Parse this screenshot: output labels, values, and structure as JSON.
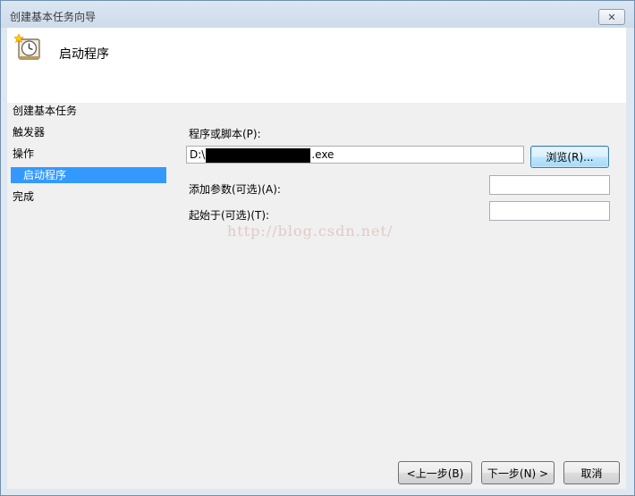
{
  "window": {
    "title": "创建基本任务向导",
    "close_glyph": "✕"
  },
  "header": {
    "title": "启动程序",
    "icon": "task-scheduler-clock-icon"
  },
  "nav": {
    "items": [
      {
        "label": "创建基本任务"
      },
      {
        "label": "触发器"
      },
      {
        "label": "操作"
      },
      {
        "label": "启动程序"
      },
      {
        "label": "完成"
      }
    ],
    "selected": "启动程序"
  },
  "form": {
    "program_label": "程序或脚本(P):",
    "program_value_prefix": "D:\\",
    "program_value_suffix": ".exe",
    "browse_label": "浏览(R)...",
    "args_label": "添加参数(可选)(A):",
    "args_value": "",
    "start_in_label": "起始于(可选)(T):",
    "start_in_value": ""
  },
  "watermark": "http://blog.csdn.net/",
  "footer": {
    "back_label": "<上一步(B)",
    "next_label": "下一步(N) >",
    "cancel_label": "取消"
  }
}
